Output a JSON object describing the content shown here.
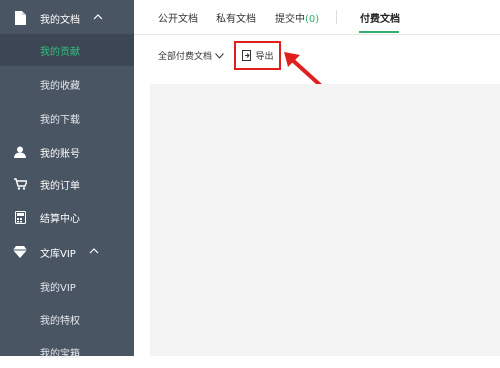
{
  "sidebar": {
    "my_docs": "我的文档",
    "items_docs": [
      "我的贡献",
      "我的收藏",
      "我的下载"
    ],
    "account": "我的账号",
    "orders": "我的订单",
    "billing": "结算中心",
    "vip": "文库VIP",
    "items_vip": [
      "我的VIP",
      "我的特权",
      "我的宝箱"
    ]
  },
  "tabs": {
    "public": "公开文档",
    "private": "私有文档",
    "pending_label": "提交中",
    "pending_count": "(0)",
    "paid": "付费文档"
  },
  "toolbar": {
    "filter": "全部付费文档",
    "export": "导出"
  },
  "colors": {
    "accent": "#2fb070",
    "sidebar_bg": "#4a5563",
    "highlight": "#e0201d"
  }
}
